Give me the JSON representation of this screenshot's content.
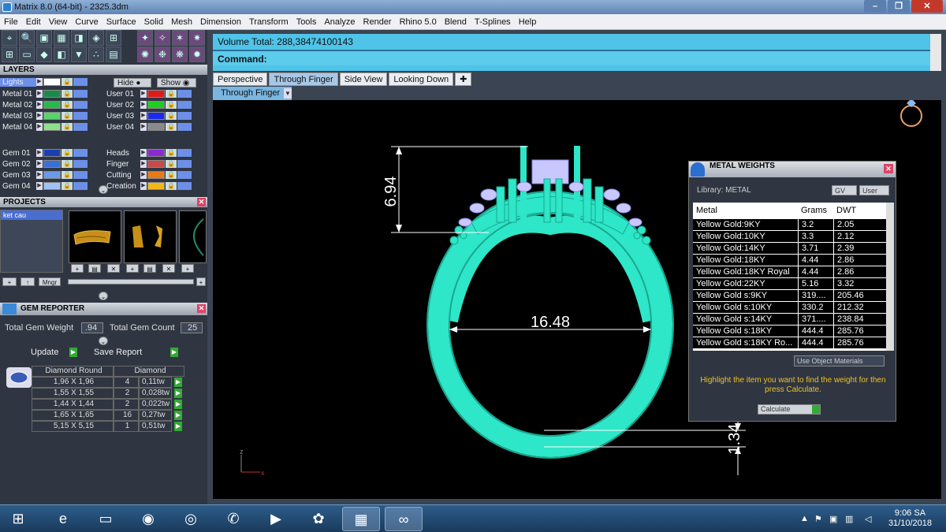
{
  "title": "Matrix 8.0 (64-bit) - 2325.3dm",
  "window_buttons": [
    "–",
    "❐",
    "✕"
  ],
  "menu": [
    "File",
    "Edit",
    "View",
    "Curve",
    "Surface",
    "Solid",
    "Mesh",
    "Dimension",
    "Transform",
    "Tools",
    "Analyze",
    "Render",
    "Rhino 5.0",
    "Blend",
    "T-Splines",
    "Help"
  ],
  "layers": {
    "header": "LAYERS",
    "lights": "Lights",
    "hide": "Hide",
    "show": "Show",
    "left": [
      {
        "name": "Metal 01",
        "color": "#1a8a4a"
      },
      {
        "name": "Metal 02",
        "color": "#2bb84a"
      },
      {
        "name": "Metal 03",
        "color": "#57d46a"
      },
      {
        "name": "Metal 04",
        "color": "#8ee08a"
      },
      {
        "name": "Gem 01",
        "color": "#1a3fb0"
      },
      {
        "name": "Gem 02",
        "color": "#3a6fd8"
      },
      {
        "name": "Gem 03",
        "color": "#6a9ae8"
      },
      {
        "name": "Gem 04",
        "color": "#a0c2f2"
      }
    ],
    "right": [
      {
        "name": "User 01",
        "color": "#e01a1a"
      },
      {
        "name": "User 02",
        "color": "#22cc22"
      },
      {
        "name": "User 03",
        "color": "#1a2ae8"
      },
      {
        "name": "User 04",
        "color": "#8a8a8a"
      },
      {
        "name": "Heads",
        "color": "#8a2ad0"
      },
      {
        "name": "Finger",
        "color": "#c84a4a"
      },
      {
        "name": "Cutting",
        "color": "#e87a1a"
      },
      {
        "name": "Creation",
        "color": "#f0b81a"
      }
    ]
  },
  "projects": {
    "header": "PROJECTS",
    "item": "ket cau",
    "thumb_numbers": [
      "1",
      "2",
      "3"
    ],
    "mngr": "Mngr"
  },
  "gem_reporter": {
    "header": "GEM REPORTER",
    "total_weight_label": "Total Gem Weight",
    "total_weight": ".94",
    "total_count_label": "Total Gem Count",
    "total_count": "25",
    "update": "Update",
    "save_report": "Save Report",
    "col1": "Diamond Round",
    "col2": "Diamond",
    "rows": [
      {
        "size": "1,96 X 1,96",
        "count": "4",
        "tw": "0,11tw"
      },
      {
        "size": "1,55 X 1,55",
        "count": "2",
        "tw": "0,028tw"
      },
      {
        "size": "1,44 X 1,44",
        "count": "2",
        "tw": "0,022tw"
      },
      {
        "size": "1,65 X 1,65",
        "count": "16",
        "tw": "0,27tw"
      },
      {
        "size": "5,15 X 5,15",
        "count": "1",
        "tw": "0,51tw"
      }
    ]
  },
  "command": {
    "volume": "Volume Total: 288,38474100143",
    "prompt": "Command:"
  },
  "tabs": [
    "Perspective",
    "Through Finger",
    "Side View",
    "Looking Down"
  ],
  "active_tab": "Through Finger",
  "viewport_label": "Through Finger",
  "dimensions": {
    "height": "6.94",
    "inner": "16.48",
    "band": "1.34"
  },
  "axes": {
    "z": "z",
    "x": "x"
  },
  "metal_weights": {
    "header": "METAL WEIGHTS",
    "library": "Library: METAL",
    "gv": "GV",
    "user": "User",
    "col_metal": "Metal",
    "col_grams": "Grams",
    "col_dwt": "DWT",
    "rows": [
      [
        "Yellow Gold:9KY",
        "3.2",
        "2.05"
      ],
      [
        "Yellow Gold:10KY",
        "3.3",
        "2.12"
      ],
      [
        "Yellow Gold:14KY",
        "3.71",
        "2.39"
      ],
      [
        "Yellow Gold:18KY",
        "4.44",
        "2.86"
      ],
      [
        "Yellow Gold:18KY Royal",
        "4.44",
        "2.86"
      ],
      [
        "Yellow Gold:22KY",
        "5.16",
        "3.32"
      ],
      [
        "Yellow Gold s:9KY",
        "319....",
        "205.46"
      ],
      [
        "Yellow Gold s:10KY",
        "330.2",
        "212.32"
      ],
      [
        "Yellow Gold s:14KY",
        "371....",
        "238.84"
      ],
      [
        "Yellow Gold s:18KY",
        "444.4",
        "285.76"
      ],
      [
        "Yellow Gold s:18KY Ro...",
        "444.4",
        "285.76"
      ]
    ],
    "use_object": "Use Object Materials",
    "hint": "Highlight the item you want to find the weight for then press Calculate.",
    "calculate": "Calculate"
  },
  "taskbar": {
    "time": "9:06 SA",
    "date": "31/10/2018"
  },
  "colors": {
    "ring": "#2ee6c8",
    "command_bg": "#4fc3e8",
    "hint": "#f0c020"
  }
}
